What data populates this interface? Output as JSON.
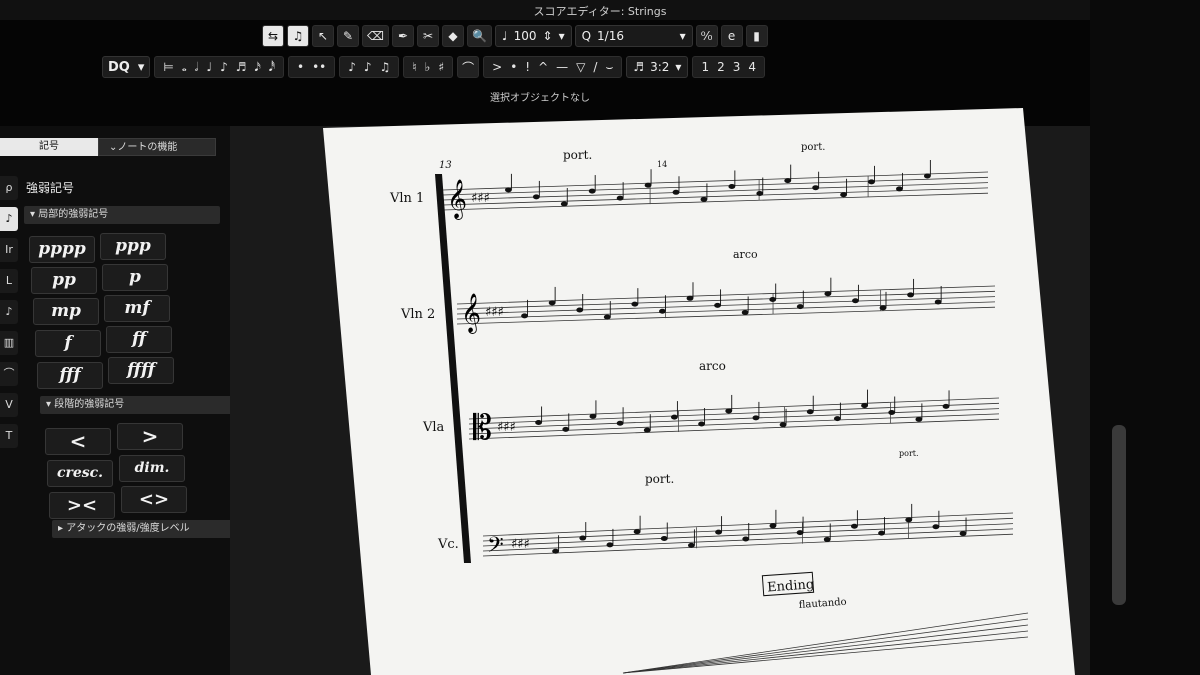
{
  "window": {
    "title": "スコアエディター: Strings"
  },
  "toolbar1": {
    "buttons": [
      "⇆",
      "♫",
      "↖",
      "✎",
      "⌫",
      "✒",
      "✂",
      "◆",
      "🔍"
    ],
    "quantize": "100",
    "quant_value": "1/16",
    "extras": [
      "⁰⁄₀",
      "e",
      "▮"
    ]
  },
  "toolbar2": {
    "dq": "DQ",
    "note_values": [
      "⊨",
      "𝅝",
      "𝅗𝅥",
      "♩",
      "♪",
      "♬",
      "𝅘𝅥𝅯",
      "𝅘𝅥𝅰"
    ],
    "dots": [
      "•",
      "••"
    ],
    "accidentals": [
      "♮",
      "♭",
      "♯"
    ],
    "articulations": [
      "⌒",
      ">",
      "•",
      "!",
      "^",
      "—",
      "▽",
      "/",
      "⌣"
    ],
    "tuplet": "3:2",
    "voices": [
      "1",
      "2",
      "3",
      "4"
    ]
  },
  "status": "選択オブジェクトなし",
  "panel": {
    "tab_active": "記号",
    "tab_inactive": "ノートの機能",
    "title": "強弱記号",
    "section1": "局部的強弱記号",
    "dynamics": [
      "pppp",
      "ppp",
      "pp",
      "p",
      "mp",
      "mf",
      "f",
      "ff",
      "fff",
      "ffff"
    ],
    "section2": "段階的強弱記号",
    "gradual": [
      "<",
      ">",
      "cresc.",
      "dim.",
      "><",
      "<>"
    ],
    "section3": "アタックの強弱/強度レベル",
    "strip": [
      "ρ",
      "♪",
      "Ir",
      "L",
      "♪",
      "▥",
      "⌒",
      "V",
      "T"
    ]
  },
  "score": {
    "instruments": [
      "Vln 1",
      "Vln 2",
      "Vla",
      "Vc."
    ],
    "measure_13": "13",
    "measure_14": "14",
    "marks": [
      "port.",
      "port.",
      "arco",
      "arco",
      "port.",
      "port."
    ],
    "ending": "Ending",
    "flautando": "flautando"
  }
}
